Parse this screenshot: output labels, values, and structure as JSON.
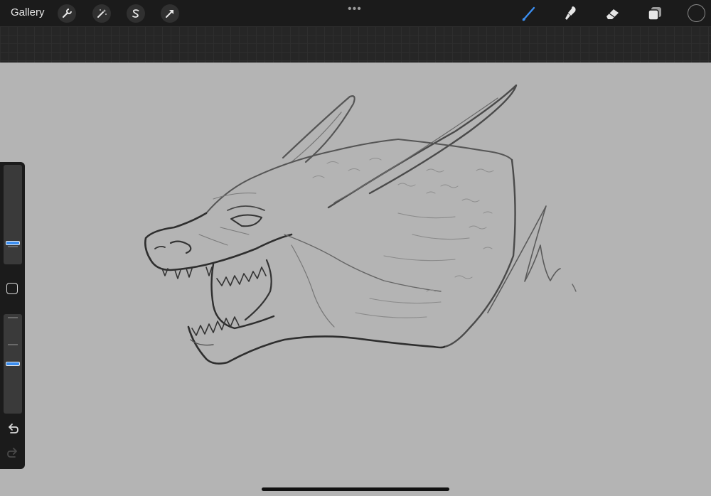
{
  "topbar": {
    "gallery_label": "Gallery",
    "action_icons": [
      "wrench-icon",
      "magic-wand-icon",
      "selection-s-icon",
      "transform-arrow-icon"
    ],
    "more_dots": "•••",
    "right_tools": [
      "brush-icon",
      "smudge-icon",
      "eraser-icon",
      "layers-icon"
    ],
    "active_tool": "brush",
    "active_tool_color": "#3b8ef0",
    "current_color": "#1b1b1b"
  },
  "sidebar": {
    "brush_size_level": 0.18,
    "opacity_level": 0.5,
    "icons": [
      "modify-square-icon",
      "undo-icon",
      "redo-icon"
    ],
    "accent_color": "#3b8ef0"
  },
  "canvas": {
    "background": "#b4b4b4",
    "artwork": "dragon-head-sketch"
  }
}
